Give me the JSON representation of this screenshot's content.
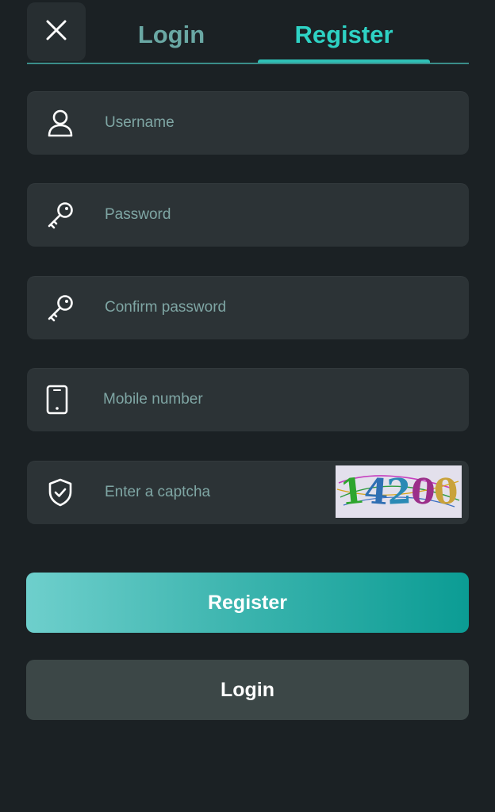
{
  "header": {
    "tabs": [
      {
        "label": "Login",
        "active": false
      },
      {
        "label": "Register",
        "active": true
      }
    ]
  },
  "form": {
    "username": {
      "placeholder": "Username",
      "value": ""
    },
    "password": {
      "placeholder": "Password",
      "value": ""
    },
    "confirm_password": {
      "placeholder": "Confirm password",
      "value": ""
    },
    "mobile": {
      "placeholder": "Mobile number",
      "value": ""
    },
    "captcha": {
      "placeholder": "Enter a captcha",
      "value": "",
      "image_code": "14200"
    }
  },
  "buttons": {
    "register_label": "Register",
    "login_label": "Login"
  },
  "icons": {
    "close": "close-icon",
    "username": "user-icon",
    "password": "key-icon",
    "confirm_password": "key-icon",
    "mobile": "phone-icon",
    "captcha": "shield-check-icon"
  },
  "colors": {
    "background": "#1b2124",
    "field": "#2c3336",
    "accent": "#2ed2c4",
    "tab_inactive": "#6aa8a4",
    "placeholder": "#7fa6a4",
    "register_gradient_start": "#6ecfcc",
    "register_gradient_end": "#0b9c94",
    "login_button": "#3c4747"
  }
}
